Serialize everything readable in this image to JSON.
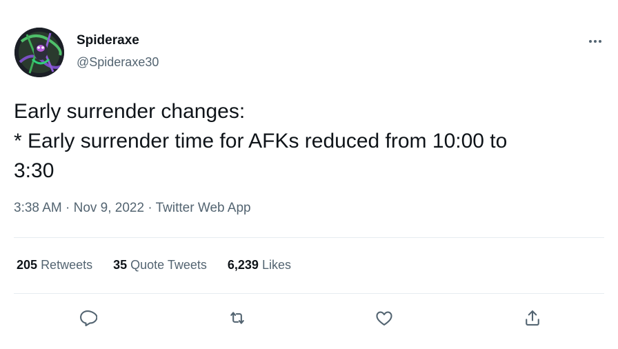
{
  "tweet": {
    "author": {
      "display_name": "Spideraxe",
      "handle": "@Spideraxe30",
      "avatar_icon": "avatar-image"
    },
    "text_lines": [
      "Early surrender changes:",
      "* Early surrender time for AFKs reduced from 10:00 to",
      "3:30"
    ],
    "time": "3:38 AM",
    "date": "Nov 9, 2022",
    "source": "Twitter Web App",
    "separator": "·"
  },
  "stats": [
    {
      "value": "205",
      "label": "Retweets"
    },
    {
      "value": "35",
      "label": "Quote Tweets"
    },
    {
      "value": "6,239",
      "label": "Likes"
    }
  ],
  "actions": [
    {
      "icon": "reply-icon"
    },
    {
      "icon": "retweet-icon"
    },
    {
      "icon": "like-icon"
    },
    {
      "icon": "share-icon"
    }
  ],
  "more_icon": "more-options-icon",
  "colors": {
    "text": "#0f1419",
    "secondary": "#536471",
    "divider": "#e6ecf0"
  }
}
